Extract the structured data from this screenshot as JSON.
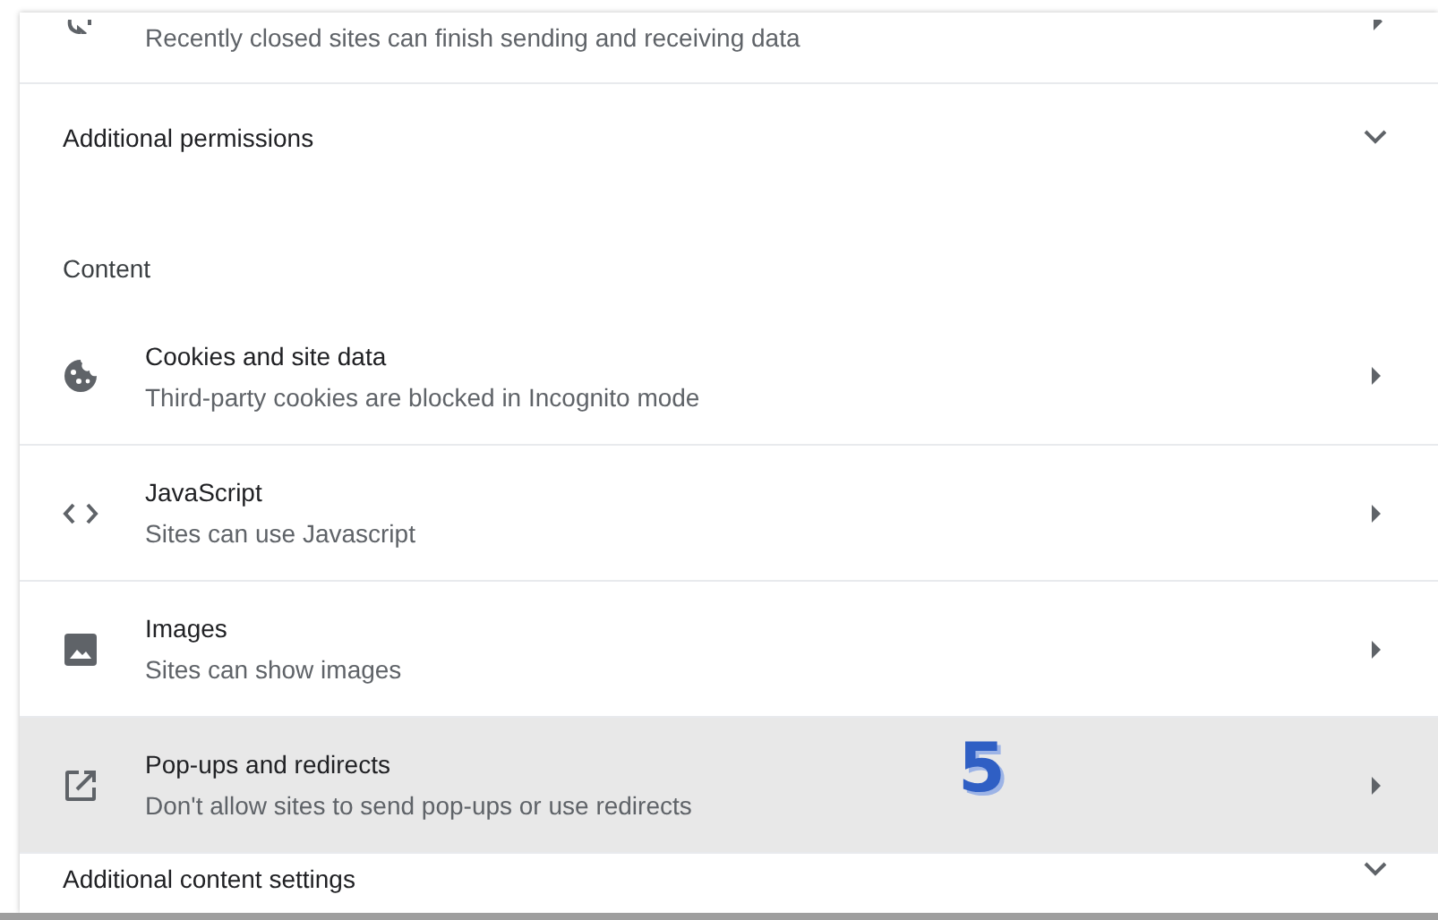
{
  "top_row": {
    "subtitle": "Recently closed sites can finish sending and receiving data"
  },
  "additional_permissions": {
    "label": "Additional permissions",
    "expanded": false
  },
  "content_heading": "Content",
  "content_items": [
    {
      "title": "Cookies and site data",
      "subtitle": "Third-party cookies are blocked in Incognito mode",
      "highlighted": false
    },
    {
      "title": "JavaScript",
      "subtitle": "Sites can use Javascript",
      "highlighted": false
    },
    {
      "title": "Images",
      "subtitle": "Sites can show images",
      "highlighted": false
    },
    {
      "title": "Pop-ups and redirects",
      "subtitle": "Don't allow sites to send pop-ups or use redirects",
      "highlighted": true
    }
  ],
  "step_marker": "5",
  "additional_content_settings": {
    "label": "Additional content settings",
    "expanded": false
  }
}
